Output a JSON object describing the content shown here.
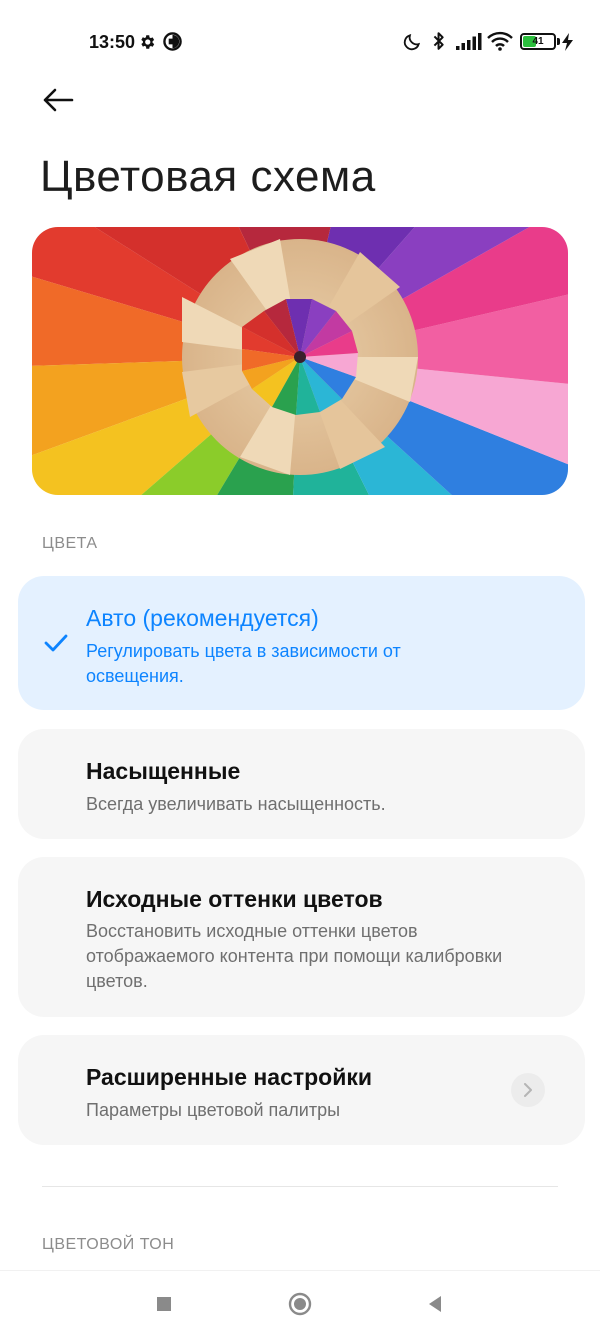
{
  "status_bar": {
    "time": "13:50",
    "battery_level": "41",
    "icons": [
      "gear-icon",
      "data-saver-icon",
      "moon-icon",
      "bluetooth-icon",
      "signal-icon",
      "wifi-icon",
      "battery-icon",
      "charging-icon"
    ]
  },
  "header": {
    "back_icon": "arrow-left-icon",
    "title": "Цветовая схема"
  },
  "banner": {
    "image": "colored-pencils-photo"
  },
  "colors_section": {
    "header": "ЦВЕТА",
    "options": [
      {
        "title": "Авто (рекомендуется)",
        "description": "Регулировать цвета в зависимости от освещения.",
        "selected": true
      },
      {
        "title": "Насыщенные",
        "description": "Всегда увеличивать насыщенность.",
        "selected": false
      },
      {
        "title": "Исходные оттенки цветов",
        "description": "Восстановить исходные оттенки цветов отображаемого контента при помощи калибровки цветов.",
        "selected": false
      },
      {
        "title": "Расширенные настройки",
        "description": "Параметры цветовой палитры",
        "selected": false
      }
    ]
  },
  "tone_section": {
    "header": "ЦВЕТОВОЙ ТОН"
  },
  "navigation": {
    "buttons": [
      "recents-square-icon",
      "home-circle-icon",
      "back-triangle-icon"
    ]
  },
  "colors": {
    "accent": "#0d84ff",
    "selected_bg": "#e4f1ff",
    "card_bg": "#f6f6f6",
    "section_text": "#8c8c8c"
  }
}
